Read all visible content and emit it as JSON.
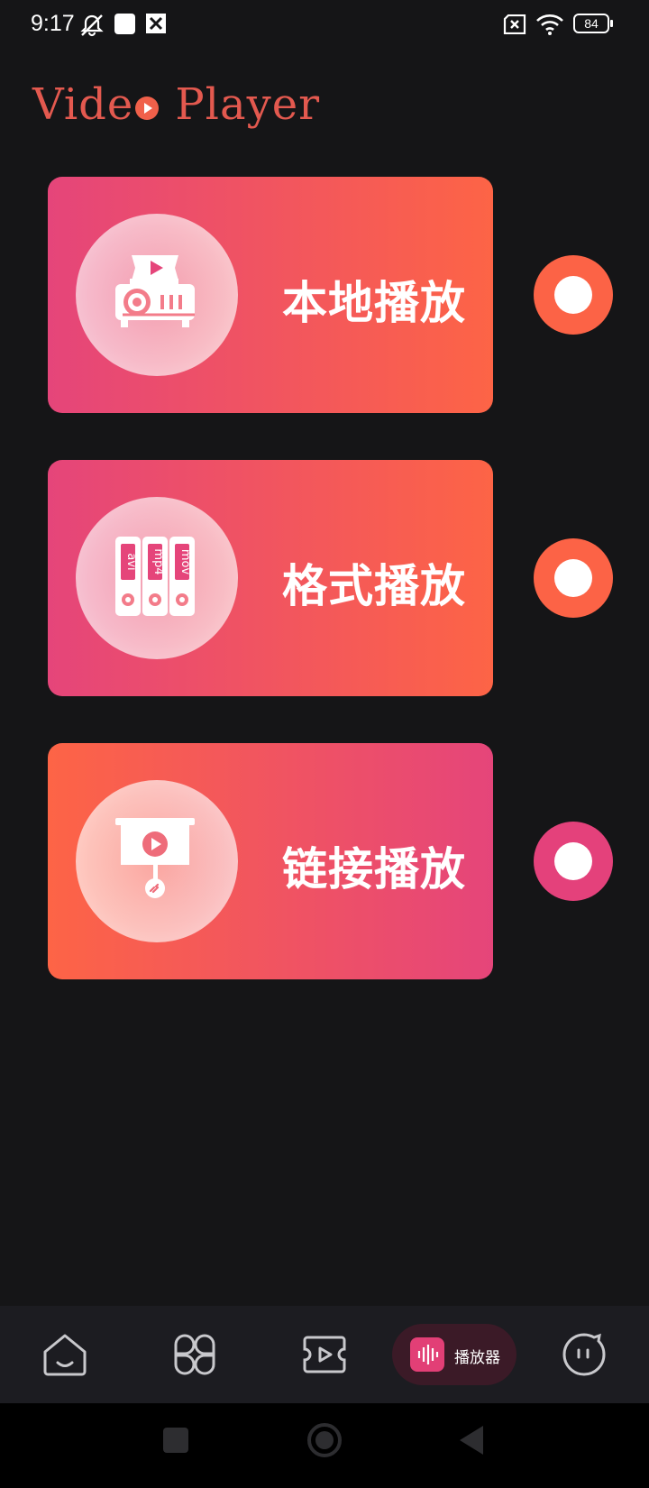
{
  "status_bar": {
    "time": "9:17",
    "battery": "84",
    "icons": [
      "mute-icon",
      "app-icon",
      "download-icon",
      "no-sim-icon",
      "wifi-icon",
      "battery-icon"
    ]
  },
  "app": {
    "title_part1": "Vide",
    "title_part2": "Player"
  },
  "cards": [
    {
      "label": "本地播放",
      "icon": "projector-icon"
    },
    {
      "label": "格式播放",
      "icon": "file-formats-icon",
      "formats": [
        "avi",
        "mp4",
        "mov"
      ]
    },
    {
      "label": "链接播放",
      "icon": "link-screen-icon"
    }
  ],
  "bottom_nav": {
    "items": [
      "home-icon",
      "apps-icon",
      "video-icon",
      "player-icon",
      "profile-icon"
    ],
    "active_label": "播放器"
  },
  "colors": {
    "pink": "#e5457a",
    "orange": "#fd6446",
    "background": "#151517"
  }
}
